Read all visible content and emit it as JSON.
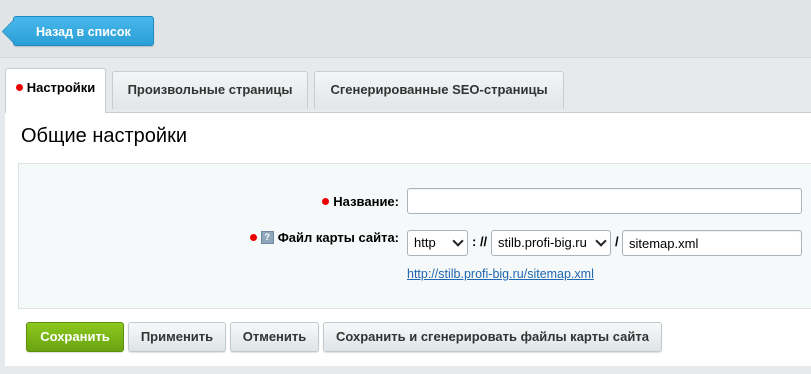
{
  "toolbar": {
    "back_label": "Назад в список"
  },
  "tabs": [
    {
      "label": "Настройки",
      "required": true,
      "active": true
    },
    {
      "label": "Произвольные страницы",
      "active": false
    },
    {
      "label": "Сгенерированные SEO-страницы",
      "active": false
    }
  ],
  "section": {
    "title": "Общие настройки"
  },
  "form": {
    "name_label": "Название:",
    "name_value": "",
    "sitemap_label": "Файл карты сайта:",
    "protocol_value": "http",
    "sep1": ": //",
    "domain_value": "stilb.profi-big.ru",
    "sep2": "/",
    "filename_value": "sitemap.xml",
    "sitemap_url": "http://stilb.profi-big.ru/sitemap.xml",
    "help_icon": "question-icon"
  },
  "actions": {
    "save": "Сохранить",
    "apply": "Применить",
    "cancel": "Отменить",
    "save_generate": "Сохранить и сгенерировать файлы карты сайта"
  },
  "colors": {
    "back_button": "#2a9fd6",
    "save_button": "#6aa311",
    "required_marker": "#ee0000",
    "link": "#2067b0"
  }
}
